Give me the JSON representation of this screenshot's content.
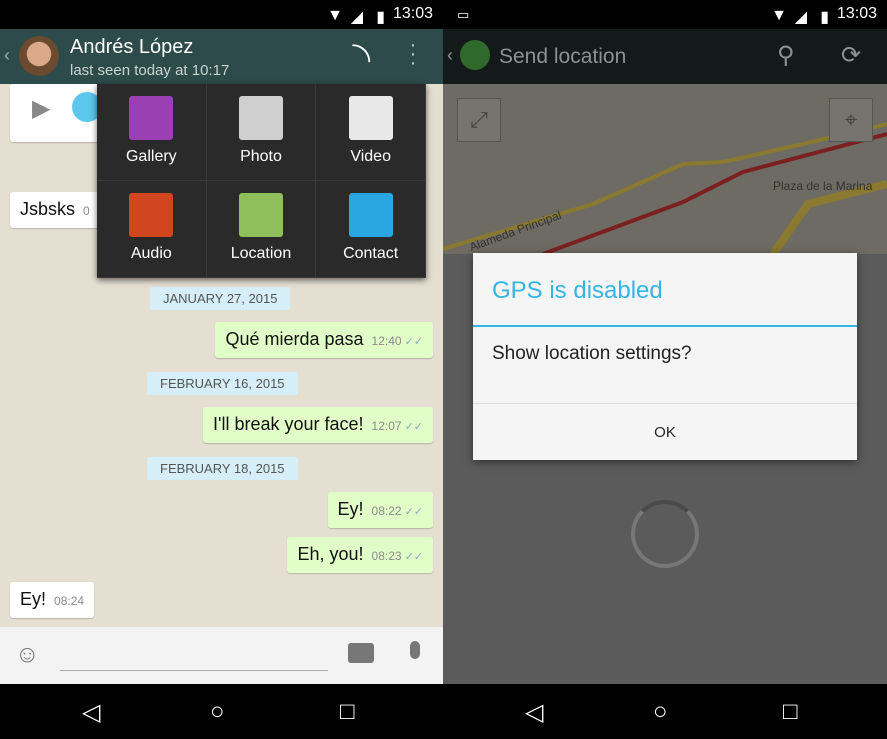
{
  "status": {
    "time": "13:03"
  },
  "chat": {
    "contact_name": "Andrés López",
    "last_seen": "last seen today at 10:17",
    "attach_menu": [
      {
        "label": "Gallery",
        "icon": "gallery-icon",
        "color": "#9b3fb5"
      },
      {
        "label": "Photo",
        "icon": "camera-icon",
        "color": "#cfcfcf"
      },
      {
        "label": "Video",
        "icon": "video-camera-icon",
        "color": "#e8e8e8"
      },
      {
        "label": "Audio",
        "icon": "microphone-icon",
        "color": "#d2461f"
      },
      {
        "label": "Location",
        "icon": "map-icon",
        "color": "#8fbf5a"
      },
      {
        "label": "Contact",
        "icon": "contact-card-icon",
        "color": "#2aa7e0"
      }
    ],
    "messages": [
      {
        "type": "in",
        "text": "Jsbsks",
        "time": "0"
      },
      {
        "type": "date",
        "text": "JANUARY 27, 2015"
      },
      {
        "type": "out",
        "text": "Qué mierda pasa",
        "time": "12:40"
      },
      {
        "type": "date",
        "text": "FEBRUARY 16, 2015"
      },
      {
        "type": "out",
        "text": "I'll break your face!",
        "time": "12:07"
      },
      {
        "type": "date",
        "text": "FEBRUARY 18, 2015"
      },
      {
        "type": "out",
        "text": "Ey!",
        "time": "08:22"
      },
      {
        "type": "out",
        "text": "Eh, you!",
        "time": "08:23"
      },
      {
        "type": "in",
        "text": "Ey!",
        "time": "08:24"
      }
    ]
  },
  "location": {
    "title": "Send location",
    "map_labels": {
      "street": "Alameda Principal",
      "place": "Plaza de la Marina"
    },
    "dialog": {
      "title": "GPS is disabled",
      "message": "Show location settings?",
      "ok": "OK",
      "accent": "#33b5e5"
    }
  }
}
